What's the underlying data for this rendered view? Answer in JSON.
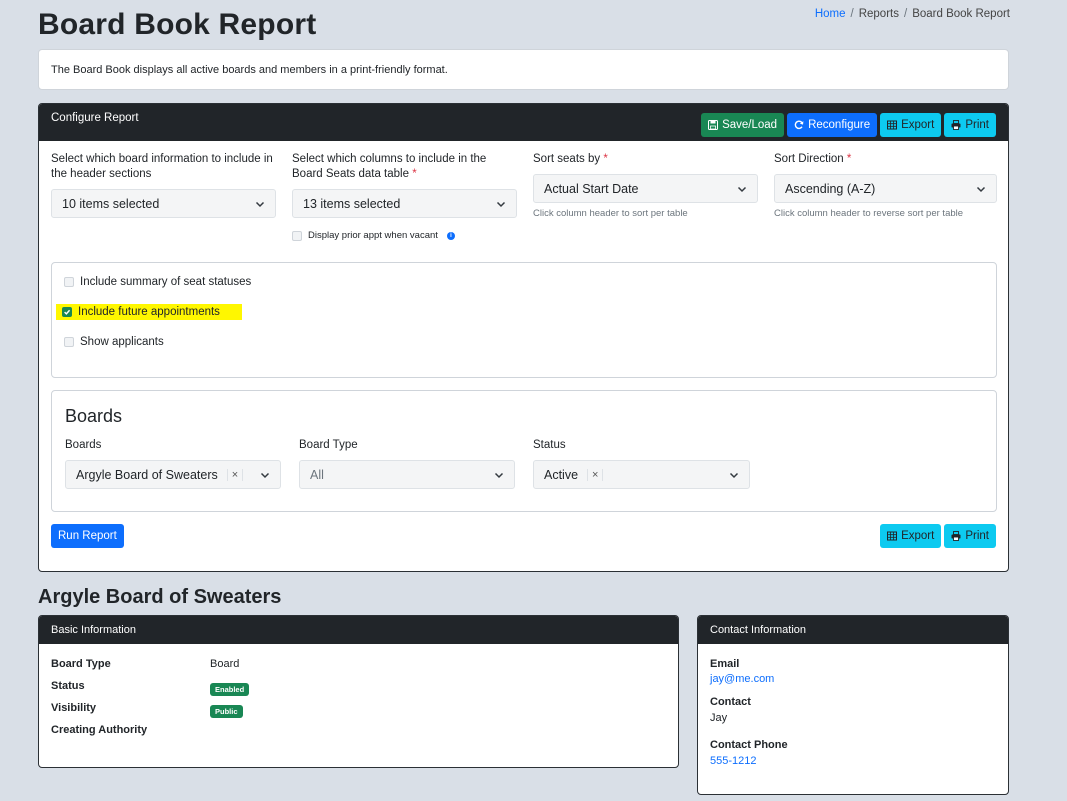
{
  "page": {
    "title": "Board Book Report",
    "description": "The Board Book displays all active boards and members in a print-friendly format."
  },
  "breadcrumb": {
    "home": "Home",
    "reports": "Reports",
    "current": "Board Book Report",
    "separator": "/"
  },
  "config": {
    "header_title": "Configure Report",
    "buttons": {
      "save_load": "Save/Load",
      "reconfigure": "Reconfigure",
      "export": "Export",
      "print": "Print"
    },
    "header_info_label": "Select which board information to include in the header sections",
    "header_info_value": "10 items selected",
    "columns_label": "Select which columns to include in the Board Seats data table",
    "columns_value": "13 items selected",
    "display_prior_label": "Display prior appt when vacant",
    "sort_seats_label": "Sort seats by",
    "sort_seats_value": "Actual Start Date",
    "sort_seats_help": "Click column header to sort per table",
    "sort_direction_label": "Sort Direction",
    "sort_direction_value": "Ascending (A-Z)",
    "sort_direction_help": "Click column header to reverse sort per table",
    "required_mark": "*",
    "options": {
      "summary_label": "Include summary of seat statuses",
      "future_label": "Include future appointments",
      "applicants_label": "Show applicants"
    },
    "boards": {
      "section_title": "Boards",
      "boards_label": "Boards",
      "boards_value": "Argyle Board of Sweaters",
      "type_label": "Board Type",
      "type_value": "All",
      "status_label": "Status",
      "status_value": "Active",
      "remove_glyph": "×"
    },
    "run_report": "Run Report",
    "footer_export": "Export",
    "footer_print": "Print"
  },
  "board": {
    "title": "Argyle Board of Sweaters",
    "basic": {
      "header": "Basic Information",
      "type_label": "Board Type",
      "type_value": "Board",
      "status_label": "Status",
      "status_value": "Enabled",
      "visibility_label": "Visibility",
      "visibility_value": "Public",
      "authority_label": "Creating Authority"
    },
    "contact": {
      "header": "Contact Information",
      "email_label": "Email",
      "email_value": "jay@me.com",
      "contact_label": "Contact",
      "contact_value": "Jay",
      "phone_label": "Contact Phone",
      "phone_value": "555-1212"
    }
  },
  "colors": {
    "background": "#d9dfe7",
    "card_header": "#212529",
    "success": "#198754",
    "primary": "#0d6efd",
    "info": "#0dcaf0",
    "highlight": "#fff700",
    "required": "#dc3545"
  }
}
